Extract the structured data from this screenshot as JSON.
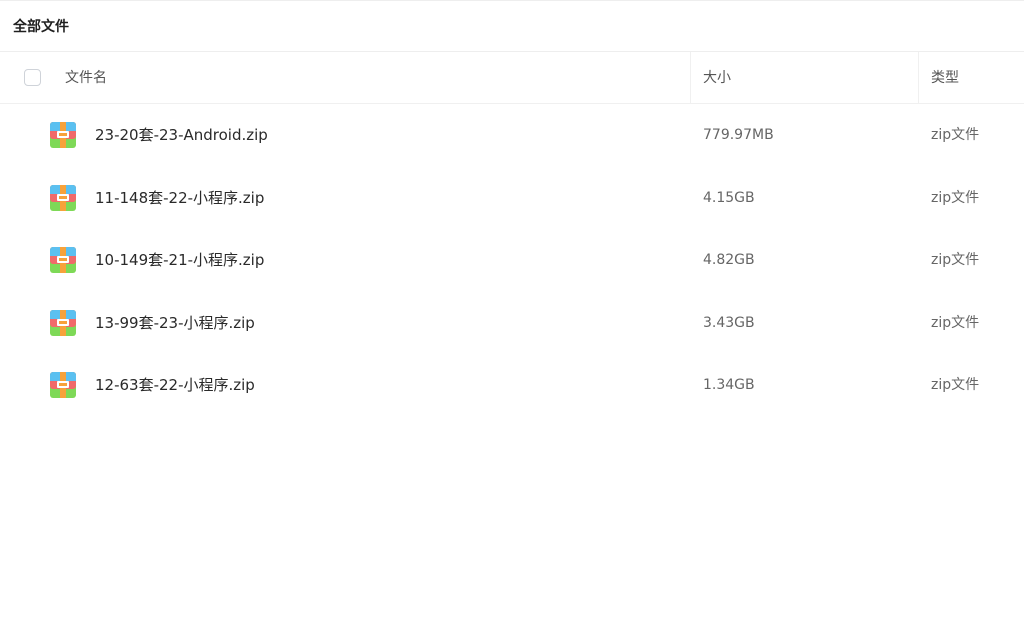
{
  "breadcrumb": {
    "title": "全部文件"
  },
  "columns": {
    "name": "文件名",
    "size": "大小",
    "type": "类型"
  },
  "files": [
    {
      "name": "23-20套-23-Android.zip",
      "size": "779.97MB",
      "type": "zip文件",
      "icon": "zip-archive-icon"
    },
    {
      "name": "11-148套-22-小程序.zip",
      "size": "4.15GB",
      "type": "zip文件",
      "icon": "zip-archive-icon"
    },
    {
      "name": "10-149套-21-小程序.zip",
      "size": "4.82GB",
      "type": "zip文件",
      "icon": "zip-archive-icon"
    },
    {
      "name": "13-99套-23-小程序.zip",
      "size": "3.43GB",
      "type": "zip文件",
      "icon": "zip-archive-icon"
    },
    {
      "name": "12-63套-22-小程序.zip",
      "size": "1.34GB",
      "type": "zip文件",
      "icon": "zip-archive-icon"
    }
  ],
  "colors": {
    "icon_top": "#5bc0f0",
    "icon_mid": "#f06a6a",
    "icon_bottom": "#7ed957",
    "icon_strap": "#f7a23b"
  }
}
